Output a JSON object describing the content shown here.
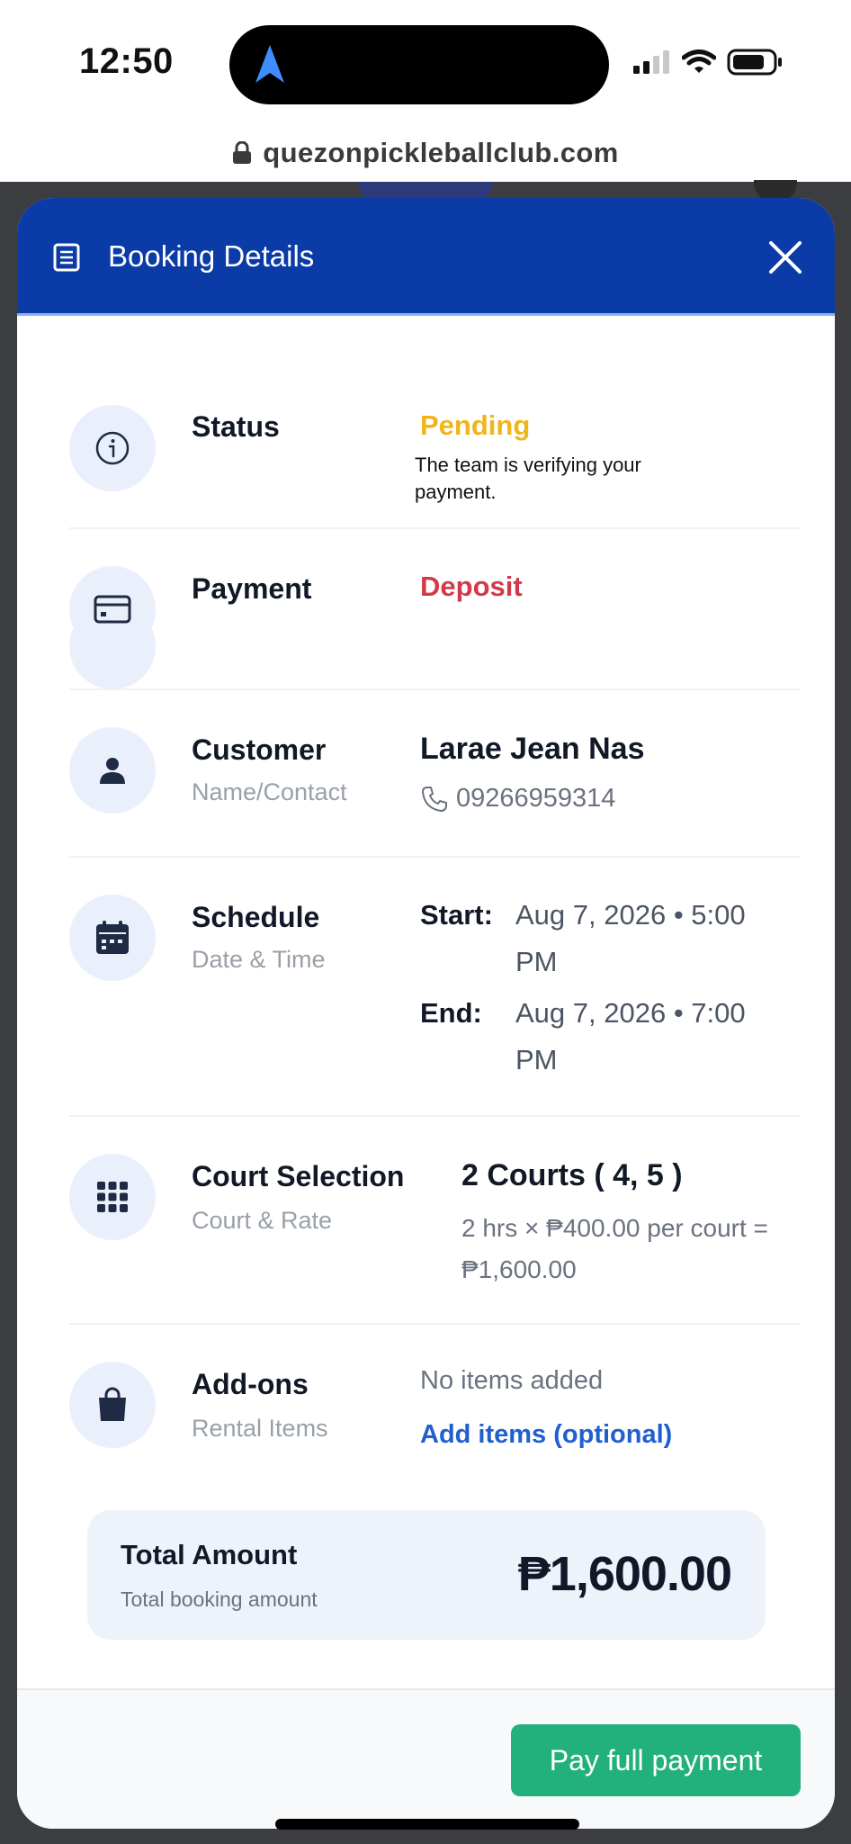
{
  "status_bar": {
    "time": "12:50"
  },
  "browser": {
    "url": "quezonpickleballclub.com"
  },
  "modal": {
    "title": "Booking Details",
    "colors": {
      "header": "#0a3ba6",
      "pending": "#f0b51c",
      "deposit": "#d23a49",
      "link": "#1f5fd0",
      "button": "#22b07d"
    },
    "status": {
      "label": "Status",
      "value": "Pending",
      "note": "The team is verifying your payment."
    },
    "payment": {
      "label": "Payment",
      "value": "Deposit"
    },
    "customer": {
      "label": "Customer",
      "sublabel": "Name/Contact",
      "name": "Larae Jean Nas",
      "phone": "09266959314"
    },
    "schedule": {
      "label": "Schedule",
      "sublabel": "Date & Time",
      "start_label": "Start:",
      "start_value": "Aug 7, 2026 • 5:00 PM",
      "end_label": "End:",
      "end_value": "Aug 7, 2026 • 7:00 PM"
    },
    "court": {
      "label": "Court Selection",
      "sublabel": "Court & Rate",
      "title": "2 Courts ( 4, 5 )",
      "calc": "2 hrs × ₱400.00 per court = ₱1,600.00"
    },
    "addons": {
      "label": "Add-ons",
      "sublabel": "Rental Items",
      "empty": "No items added",
      "add_link": "Add items (optional)"
    },
    "total": {
      "label": "Total Amount",
      "sublabel": "Total booking amount",
      "value": "₱1,600.00"
    },
    "pay_button": "Pay full payment"
  },
  "icons": [
    "navigation-arrow-icon",
    "signal-icon",
    "wifi-icon",
    "battery-icon",
    "lock-icon",
    "receipt-icon",
    "close-icon",
    "info-icon",
    "credit-card-icon",
    "person-icon",
    "phone-icon",
    "calendar-icon",
    "grid-icon",
    "bag-icon"
  ]
}
